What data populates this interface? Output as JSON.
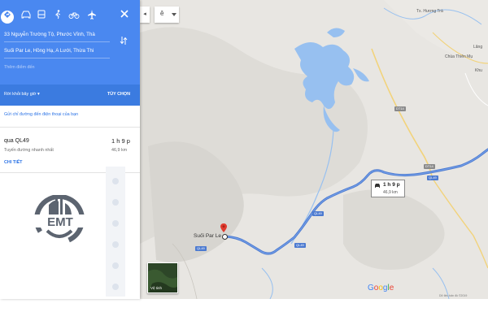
{
  "travel_modes": [
    {
      "name": "best-route",
      "active": true
    },
    {
      "name": "car"
    },
    {
      "name": "transit"
    },
    {
      "name": "walking"
    },
    {
      "name": "cycling"
    },
    {
      "name": "flight"
    }
  ],
  "directions": {
    "origin": "33 Nguyễn Trường Tộ, Phước Vĩnh, Thà",
    "destination": "Suối Par Le, Hồng Hạ, A Lưới, Thừa Thi",
    "add_stop_placeholder": "Thêm điểm đến",
    "leave_now": "Rời khỏi bây giờ",
    "leave_now_caret": "▾",
    "options": "TÙY CHỌN"
  },
  "send_to_phone": "Gửi chỉ đường đến điện thoại của bạn",
  "route": {
    "via": "qua QL49",
    "time": "1 h 9 p",
    "description": "Tuyến đường nhanh nhất",
    "distance": "46,9 km",
    "details_link": "CHI TIẾT"
  },
  "logo": {
    "text": "EMT",
    "color": "#5c6470"
  },
  "map": {
    "language_control": "ê",
    "collapse_glyph": "◂",
    "labels": {
      "huong_tra": "Tx. Hương Trà",
      "chua_thien_mu": "Chùa Thiên Mụ",
      "lang": "Lăng",
      "khu": "Khu"
    },
    "road_badges": {
      "dt14_top": "DT14",
      "dt14_mid": "DT14",
      "ql49_a": "QL49",
      "ql49_b": "QL49",
      "ql49_c": "QL49",
      "ql49_d": "QL49"
    },
    "callout": {
      "time": "1 h 9 p",
      "distance": "46,9 km"
    },
    "destination_label": "Suối Par Le",
    "satellite_label": "Vệ tinh",
    "google_logo": "Google",
    "copyright": "Dữ liệu bản đồ ©2019"
  },
  "colors": {
    "header_blue": "#4a88f0",
    "route_blue": "#4c7ad0",
    "water_blue": "#97c0f0",
    "pin_red": "#e03a2e",
    "link_blue": "#2b73e6"
  }
}
